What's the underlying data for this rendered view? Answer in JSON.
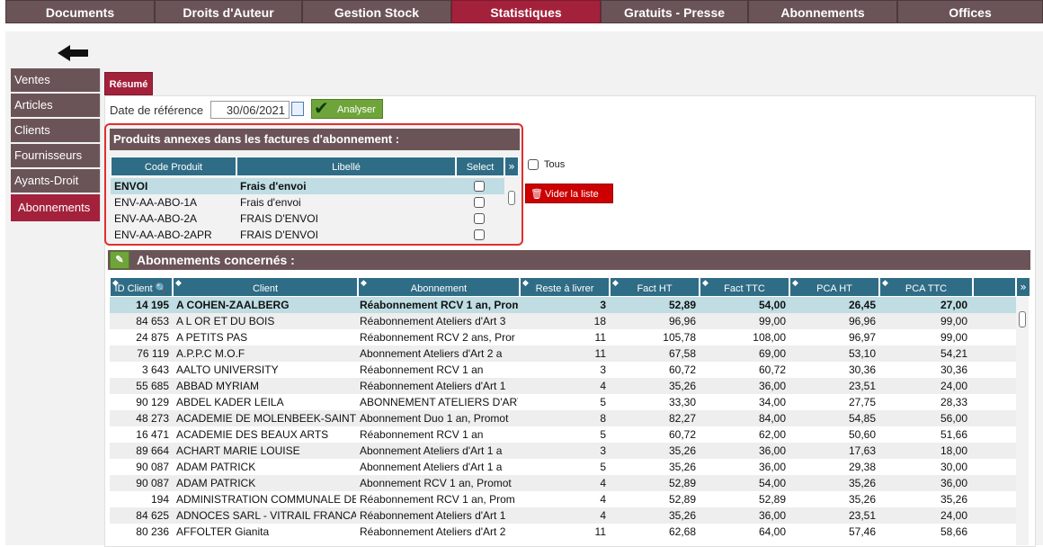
{
  "top_nav": {
    "tabs": [
      {
        "label": "Documents"
      },
      {
        "label": "Droits d'Auteur"
      },
      {
        "label": "Gestion Stock"
      },
      {
        "label": "Statistiques"
      },
      {
        "label": "Gratuits - Presse"
      },
      {
        "label": "Abonnements"
      },
      {
        "label": "Offices"
      }
    ],
    "active": "Statistiques"
  },
  "side_nav": {
    "items": [
      {
        "label": "Ventes"
      },
      {
        "label": "Articles"
      },
      {
        "label": "Clients"
      },
      {
        "label": "Fournisseurs"
      },
      {
        "label": "Ayants-Droit"
      },
      {
        "label": "Abonnements"
      }
    ],
    "active": "Abonnements"
  },
  "tab_resume": {
    "label": "Résumé"
  },
  "filter": {
    "date_label": "Date de référence",
    "date_value": "30/06/2021",
    "analyser_label": "Analyser"
  },
  "annexes": {
    "title": "Produits annexes dans les factures d'abonnement :",
    "columns": [
      "Code Produit",
      "Libellé",
      "Select"
    ],
    "rows": [
      {
        "code": "ENVOI",
        "libelle": "Frais d'envoi"
      },
      {
        "code": "ENV-AA-ABO-1A",
        "libelle": "Frais d'envoi"
      },
      {
        "code": "ENV-AA-ABO-2A",
        "libelle": "FRAIS D'ENVOI"
      },
      {
        "code": "ENV-AA-ABO-2APR",
        "libelle": "FRAIS D'ENVOI"
      }
    ],
    "tous_label": "Tous",
    "vider_label": "Vider la liste"
  },
  "abonnements": {
    "title": "Abonnements concernés :",
    "columns": [
      "ID Client",
      "Client",
      "Abonnement",
      "Reste à livrer",
      "Fact HT",
      "Fact TTC",
      "PCA HT",
      "PCA TTC"
    ],
    "rows": [
      {
        "id": "14 195",
        "client": "A COHEN-ZAALBERG",
        "abonnement": "Réabonnement RCV 1 an, Prom",
        "reste": "3",
        "fact_ht": "52,89",
        "fact_ttc": "54,00",
        "pca_ht": "26,45",
        "pca_ttc": "27,00"
      },
      {
        "id": "84 653",
        "client": "A L OR ET DU BOIS",
        "abonnement": "Réabonnement Ateliers d'Art 3",
        "reste": "18",
        "fact_ht": "96,96",
        "fact_ttc": "99,00",
        "pca_ht": "96,96",
        "pca_ttc": "99,00"
      },
      {
        "id": "24 875",
        "client": "A PETITS PAS",
        "abonnement": "Réabonnement RCV 2 ans, Pror",
        "reste": "11",
        "fact_ht": "105,78",
        "fact_ttc": "108,00",
        "pca_ht": "96,97",
        "pca_ttc": "99,00"
      },
      {
        "id": "76 119",
        "client": "A.P.P.C M.O.F",
        "abonnement": "Abonnement Ateliers d'Art 2 a",
        "reste": "11",
        "fact_ht": "67,58",
        "fact_ttc": "69,00",
        "pca_ht": "53,10",
        "pca_ttc": "54,21"
      },
      {
        "id": "3 643",
        "client": "AALTO UNIVERSITY",
        "abonnement": "Réabonnement RCV 1 an",
        "reste": "3",
        "fact_ht": "60,72",
        "fact_ttc": "60,72",
        "pca_ht": "30,36",
        "pca_ttc": "30,36"
      },
      {
        "id": "55 685",
        "client": "ABBAD MYRIAM",
        "abonnement": "Réabonnement Ateliers d'Art 1",
        "reste": "4",
        "fact_ht": "35,26",
        "fact_ttc": "36,00",
        "pca_ht": "23,51",
        "pca_ttc": "24,00"
      },
      {
        "id": "90 129",
        "client": "ABDEL KADER LEILA",
        "abonnement": "ABONNEMENT ATELIERS D'ART",
        "reste": "5",
        "fact_ht": "33,30",
        "fact_ttc": "34,00",
        "pca_ht": "27,75",
        "pca_ttc": "28,33"
      },
      {
        "id": "48 273",
        "client": "ACADEMIE DE MOLENBEEK-SAINT JI",
        "abonnement": "Abonnement Duo 1 an, Promot",
        "reste": "8",
        "fact_ht": "82,27",
        "fact_ttc": "84,00",
        "pca_ht": "54,85",
        "pca_ttc": "56,00"
      },
      {
        "id": "16 471",
        "client": "ACADEMIE DES BEAUX ARTS",
        "abonnement": "Réabonnement RCV 1 an",
        "reste": "5",
        "fact_ht": "60,72",
        "fact_ttc": "62,00",
        "pca_ht": "50,60",
        "pca_ttc": "51,66"
      },
      {
        "id": "89 664",
        "client": "ACHART MARIE LOUISE",
        "abonnement": "Abonnement Ateliers d'Art 1 a",
        "reste": "3",
        "fact_ht": "35,26",
        "fact_ttc": "36,00",
        "pca_ht": "17,63",
        "pca_ttc": "18,00"
      },
      {
        "id": "90 087",
        "client": "ADAM PATRICK",
        "abonnement": "Abonnement Ateliers d'Art 1 a",
        "reste": "5",
        "fact_ht": "35,26",
        "fact_ttc": "36,00",
        "pca_ht": "29,38",
        "pca_ttc": "30,00"
      },
      {
        "id": "90 087",
        "client": "ADAM PATRICK",
        "abonnement": "Abonnement RCV 1 an, Promot",
        "reste": "4",
        "fact_ht": "52,89",
        "fact_ttc": "54,00",
        "pca_ht": "35,26",
        "pca_ttc": "36,00"
      },
      {
        "id": "194",
        "client": "ADMINISTRATION COMMUNALE DE L",
        "abonnement": "Réabonnement RCV 1 an, Prom",
        "reste": "4",
        "fact_ht": "52,89",
        "fact_ttc": "52,89",
        "pca_ht": "35,26",
        "pca_ttc": "35,26"
      },
      {
        "id": "84 625",
        "client": "ADNOCES SARL - VITRAIL FRANCAIS",
        "abonnement": "Réabonnement Ateliers d'Art 1",
        "reste": "4",
        "fact_ht": "35,26",
        "fact_ttc": "36,00",
        "pca_ht": "23,51",
        "pca_ttc": "24,00"
      },
      {
        "id": "80 236",
        "client": "AFFOLTER Gianita",
        "abonnement": "Réabonnement Ateliers d'Art 2",
        "reste": "11",
        "fact_ht": "62,68",
        "fact_ttc": "64,00",
        "pca_ht": "57,46",
        "pca_ttc": "58,66"
      }
    ]
  },
  "colors": {
    "tab_bg": "#6b5457",
    "active_bg": "#a3213b",
    "table_header": "#2f6c86",
    "selected_row": "#bfdde3",
    "button_green": "#6fa43a",
    "button_red": "#cc0000",
    "highlight_border": "#e0302e"
  }
}
